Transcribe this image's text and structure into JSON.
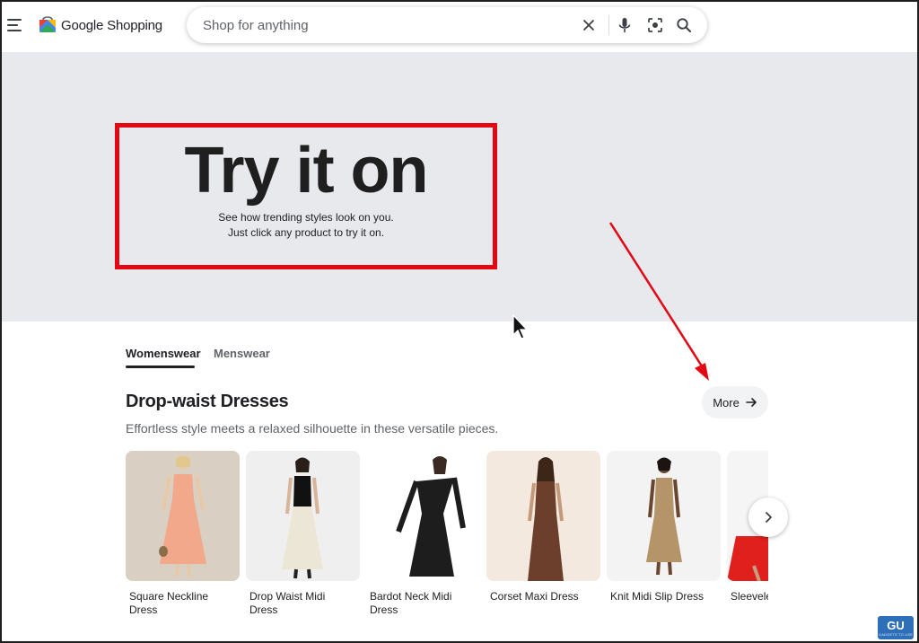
{
  "header": {
    "menu_icon": "hamburger-menu-icon",
    "logo_text": "Google Shopping",
    "search_placeholder": "Shop for anything",
    "icons": [
      "close-icon",
      "microphone-icon",
      "camera-lens-icon",
      "search-icon"
    ]
  },
  "hero": {
    "title": "Try it on",
    "subtitle_line1": "See how trending styles look on you.",
    "subtitle_line2": "Just click any product to try it on."
  },
  "tabs": [
    {
      "label": "Womenswear",
      "selected": true
    },
    {
      "label": "Menswear",
      "selected": false
    }
  ],
  "section": {
    "title": "Drop-waist Dresses",
    "description": "Effortless style meets a relaxed silhouette in these versatile pieces.",
    "more_label": "More"
  },
  "products": [
    {
      "name": "Square Neckline Dress",
      "color": "#f2a88a"
    },
    {
      "name": "Drop Waist Midi Dress",
      "color": "#ece6d6"
    },
    {
      "name": "Bardot Neck Midi Dress",
      "color": "#1d1d1d"
    },
    {
      "name": "Corset Maxi Dress",
      "color": "#6b3f2c"
    },
    {
      "name": "Knit Midi Slip Dress",
      "color": "#b49468"
    },
    {
      "name": "Sleeveless Dress",
      "color": "#e0201c"
    }
  ],
  "colors": {
    "highlight": "#e30613",
    "hero_bg": "#e8e9ec",
    "text": "#202124"
  }
}
